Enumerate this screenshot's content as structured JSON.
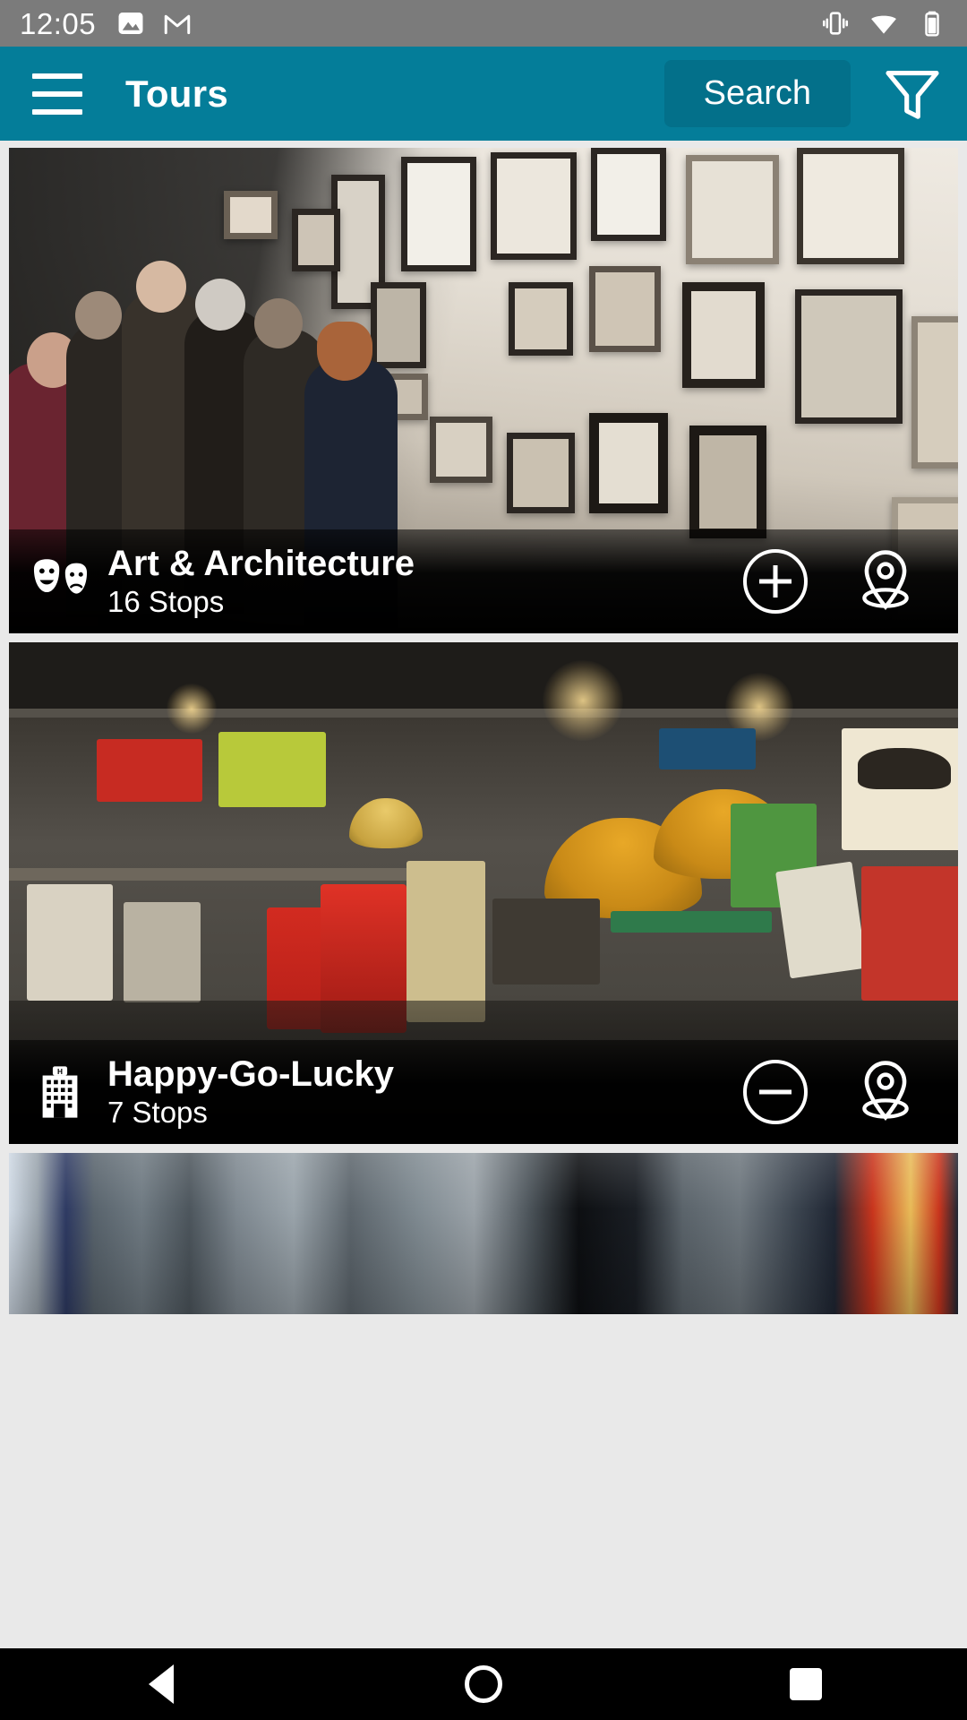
{
  "status_bar": {
    "clock": "12:05",
    "left_icons": [
      "photos-icon",
      "gmail-icon"
    ],
    "right_icons": [
      "vibrate-icon",
      "wifi-icon",
      "battery-icon"
    ]
  },
  "app_bar": {
    "menu_icon": "hamburger-menu-icon",
    "title": "Tours",
    "search_label": "Search",
    "filter_icon": "filter-funnel-icon",
    "accent_color": "#047d99",
    "search_button_color": "#03708a"
  },
  "tours": [
    {
      "title": "Art & Architecture",
      "stops": "16 Stops",
      "type_icon": "theater-masks-icon",
      "action_icon": "plus-circle-icon",
      "map_icon": "map-pin-icon",
      "photo": "art-gallery-photo"
    },
    {
      "title": "Happy-Go-Lucky",
      "stops": "7 Stops",
      "type_icon": "hotel-building-icon",
      "action_icon": "minus-circle-icon",
      "map_icon": "map-pin-icon",
      "photo": "antique-market-photo"
    },
    {
      "title": "",
      "stops": "",
      "type_icon": "",
      "action_icon": "",
      "map_icon": "",
      "photo": "fabric-clothing-photo"
    }
  ],
  "nav_bar": {
    "back_icon": "back-triangle-icon",
    "home_icon": "home-circle-icon",
    "recents_icon": "recents-square-icon"
  }
}
